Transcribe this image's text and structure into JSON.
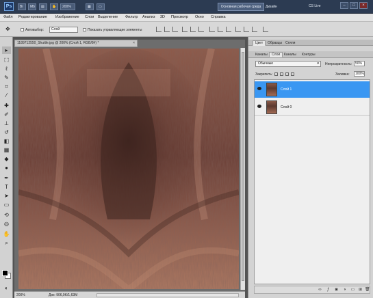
{
  "appbar": {
    "logo": "Ps",
    "zoom": "200%",
    "workspace_button": "Основная рабочая среда",
    "design_label": "Дизайн",
    "cs_live": "CS Live",
    "win_min": "–",
    "win_max": "□",
    "win_close": "×"
  },
  "menu": [
    "Файл",
    "Редактирование",
    "Изображение",
    "Слои",
    "Выделение",
    "Фильтр",
    "Анализ",
    "3D",
    "Просмотр",
    "Окно",
    "Справка"
  ],
  "options": {
    "autoselect_label": "Автовыбор:",
    "autoselect_value": "Слой",
    "show_controls_label": "Показать управляющие элементы"
  },
  "document": {
    "tab_title": "1189712550_Shuttle.jpg @ 200% (Слой 1, RGB/8#) *",
    "close": "×",
    "zoom": "200%",
    "doc_info": "Док: 906,9K/1,63M"
  },
  "panels": {
    "top_tabs": [
      "Цвет",
      "Образцы",
      "Стили"
    ],
    "tabs": [
      "Каналы",
      "Слои",
      "Каналы",
      "Контуры"
    ],
    "active_tab_index": 1,
    "blend_mode": "Обычные",
    "opacity_label": "Непрозрачность:",
    "opacity_value": "50%",
    "lock_label": "Закрепить:",
    "fill_label": "Заливка:",
    "fill_value": "100%",
    "layers": [
      {
        "name": "Слой 1",
        "selected": true
      },
      {
        "name": "Слой 0",
        "selected": false
      }
    ],
    "selection_color": "#3a97f2"
  },
  "canvas_colors": {
    "base": "#a56d59",
    "dark": "#4e2e29",
    "light": "#c48c73"
  }
}
